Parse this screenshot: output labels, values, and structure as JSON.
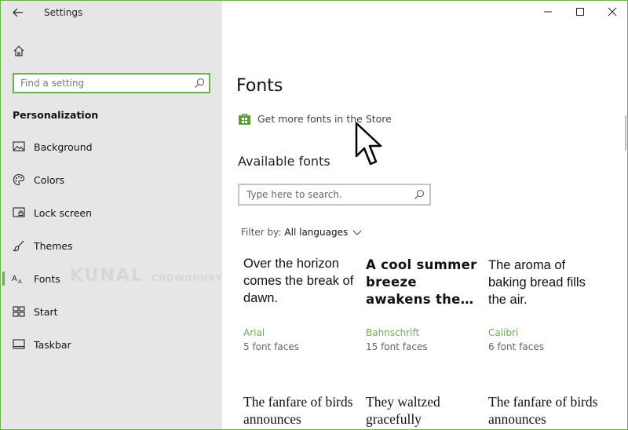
{
  "window": {
    "title": "Settings",
    "accent_color": "#6bb24a"
  },
  "sidebar": {
    "search_placeholder": "Find a setting",
    "section_title": "Personalization",
    "items": [
      {
        "label": "Background",
        "icon": "picture-icon"
      },
      {
        "label": "Colors",
        "icon": "palette-icon"
      },
      {
        "label": "Lock screen",
        "icon": "lock-screen-icon"
      },
      {
        "label": "Themes",
        "icon": "brush-icon"
      },
      {
        "label": "Fonts",
        "icon": "font-icon",
        "active": true
      },
      {
        "label": "Start",
        "icon": "start-icon"
      },
      {
        "label": "Taskbar",
        "icon": "taskbar-icon"
      }
    ],
    "watermark": "KUNAL",
    "watermark_small": "CHOWDHURY"
  },
  "main": {
    "page_title": "Fonts",
    "store_link": "Get more fonts in the Store",
    "available_title": "Available fonts",
    "search_placeholder": "Type here to search.",
    "filter_label": "Filter by:",
    "filter_value": "All languages",
    "fonts": [
      {
        "sample": "Over the horizon comes the break of dawn.",
        "name": "Arial",
        "faces": "5 font faces"
      },
      {
        "sample": "A cool summer breeze awakens the…",
        "name": "Bahnschrift",
        "faces": "15 font faces"
      },
      {
        "sample": "The aroma of baking bread fills the air.",
        "name": "Calibri",
        "faces": "6 font faces"
      },
      {
        "sample": "The fanfare of birds announces"
      },
      {
        "sample": "They waltzed gracefully"
      },
      {
        "sample": "The fanfare of birds announces"
      }
    ]
  }
}
